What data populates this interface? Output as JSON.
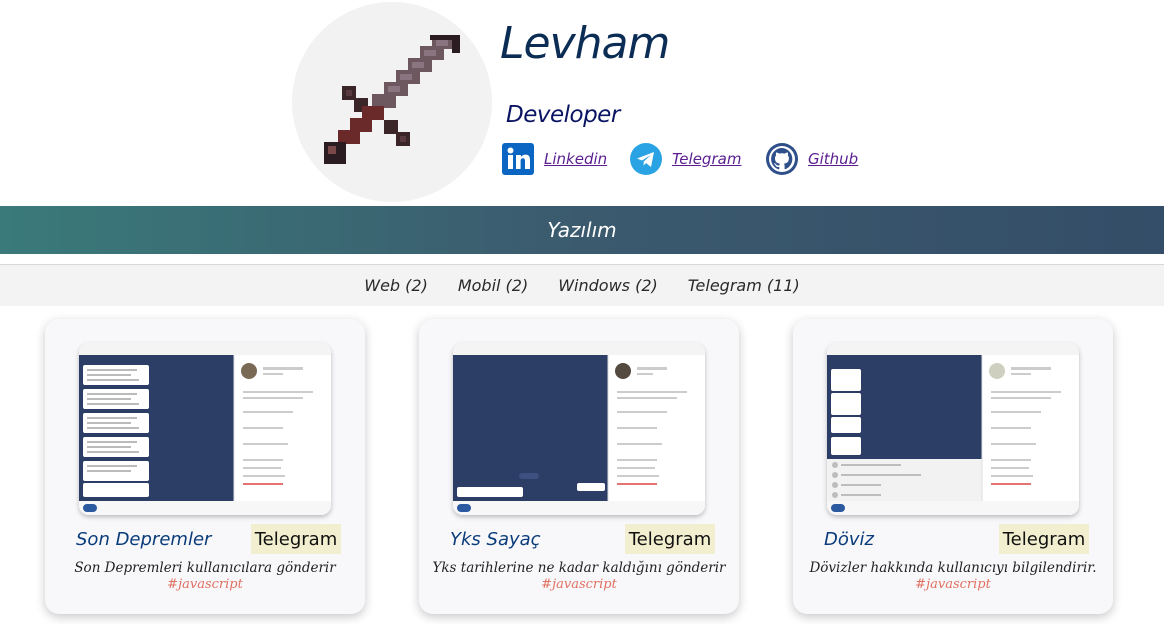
{
  "profile": {
    "name": "Levham",
    "role": "Developer",
    "links": [
      {
        "label": "Linkedin",
        "icon": "linkedin-icon",
        "color": "#0a66c2"
      },
      {
        "label": "Telegram",
        "icon": "telegram-icon",
        "color": "#2aa3e4"
      },
      {
        "label": "Github",
        "icon": "github-icon",
        "color": "#2e4f8a"
      }
    ]
  },
  "section": {
    "title": "Yazılım"
  },
  "filters": [
    "Web (2)",
    "Mobil (2)",
    "Windows (2)",
    "Telegram (11)"
  ],
  "projects": [
    {
      "title": "Son Depremler",
      "tag": "Telegram",
      "desc": "Son Depremleri kullanıcılara gönderir",
      "hashtag": "#javascript"
    },
    {
      "title": "Yks Sayaç",
      "tag": "Telegram",
      "desc": "Yks tarihlerine ne kadar kaldığını gönderir",
      "hashtag": "#javascript"
    },
    {
      "title": "Döviz",
      "tag": "Telegram",
      "desc": "Dövizler hakkında kullanıcıyı bilgilendirir.",
      "hashtag": "#javascript"
    }
  ],
  "colors": {
    "name": "#0b2d55",
    "link": "#5a1e91",
    "bar_start": "#3a7a7a",
    "bar_end": "#344d68",
    "tag_bg": "#f1efcf",
    "hashtag": "#e07060"
  }
}
